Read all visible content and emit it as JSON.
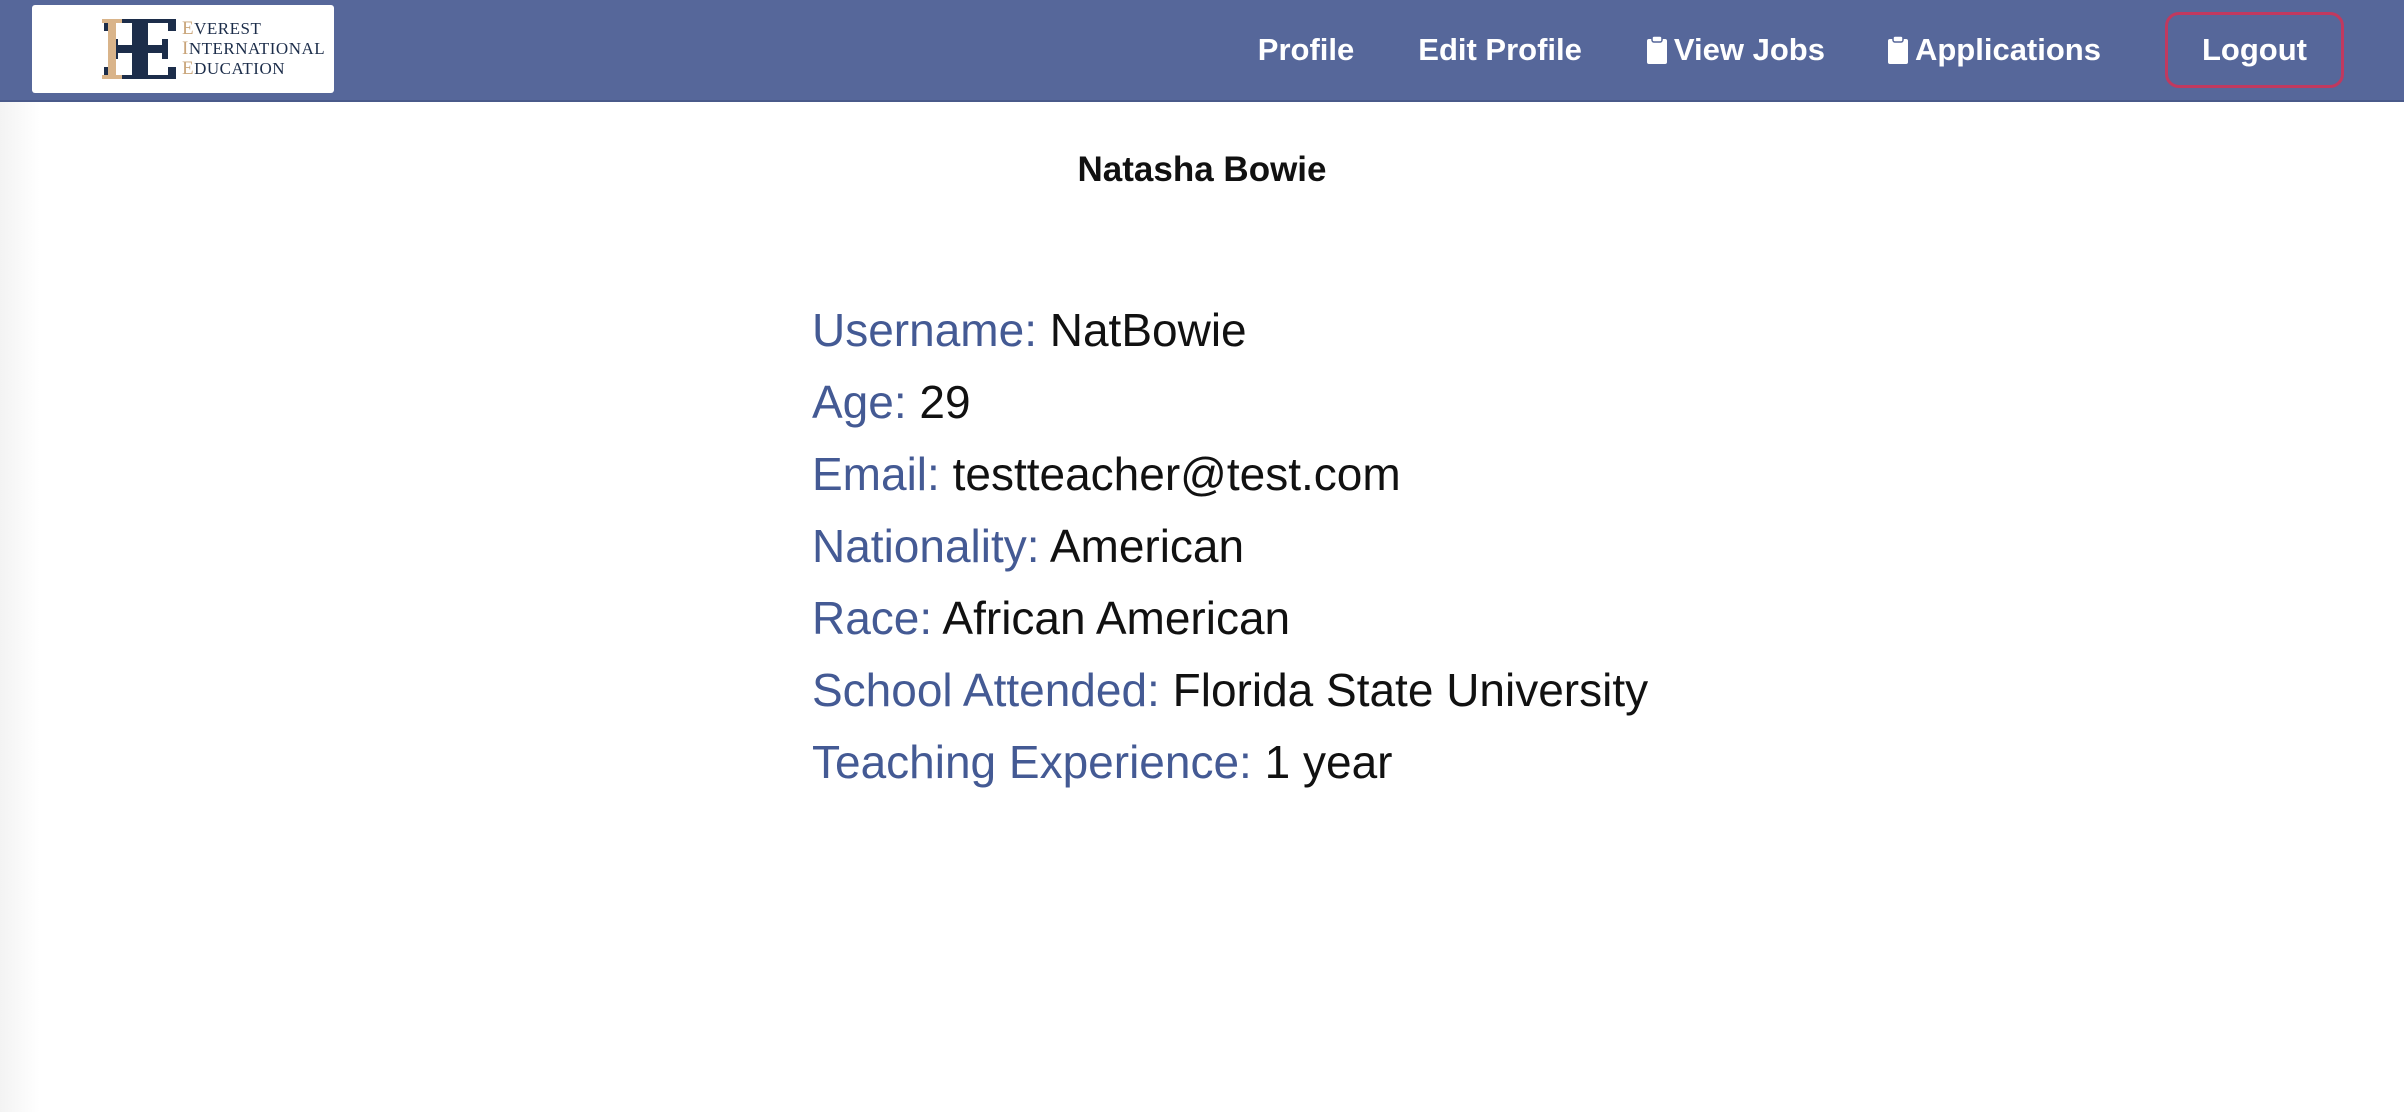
{
  "brand": {
    "lines": [
      {
        "cap": "E",
        "rest": "VEREST"
      },
      {
        "cap": "I",
        "rest": "NTERNATIONAL"
      },
      {
        "cap": "E",
        "rest": "DUCATION"
      }
    ],
    "colors": {
      "navy": "#1c2d4a",
      "gold": "#d9b48a"
    }
  },
  "nav": {
    "profile": "Profile",
    "edit_profile": "Edit Profile",
    "view_jobs": "View Jobs",
    "applications": "Applications",
    "logout": "Logout",
    "icons": {
      "view_jobs": "clipboard-icon",
      "applications": "clipboard-icon"
    }
  },
  "colors": {
    "navbar": "#56679a",
    "label": "#445a94",
    "logout_border": "#c0395f"
  },
  "profile": {
    "name": "Natasha Bowie",
    "fields": [
      {
        "label": "Username:",
        "value": "NatBowie"
      },
      {
        "label": "Age:",
        "value": "29"
      },
      {
        "label": "Email:",
        "value": "testteacher@test.com"
      },
      {
        "label": "Nationality:",
        "value": "American"
      },
      {
        "label": "Race:",
        "value": "African American"
      },
      {
        "label": "School Attended:",
        "value": "Florida State University"
      },
      {
        "label": "Teaching Experience:",
        "value": "1 year"
      }
    ]
  }
}
